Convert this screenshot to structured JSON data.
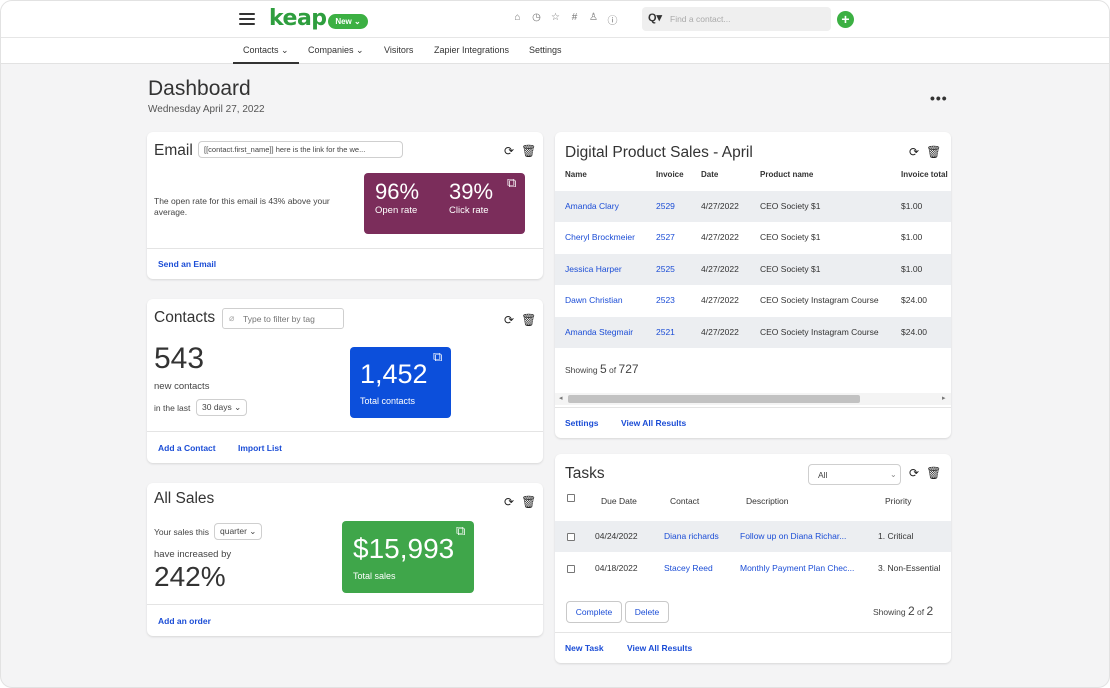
{
  "topbar": {
    "logo": "keap",
    "new_label": "New ⌄",
    "icons": [
      "home-icon",
      "history-icon",
      "star-icon",
      "hash-icon",
      "user-icon",
      "help-icon"
    ],
    "search_icon": "Q▾",
    "search_placeholder": "Find a contact...",
    "add_label": "+"
  },
  "nav": {
    "items": [
      "Contacts ⌄",
      "Companies ⌄",
      "Visitors",
      "Zapier Integrations",
      "Settings"
    ]
  },
  "header": {
    "title": "Dashboard",
    "date": "Wednesday April 27, 2022",
    "more": "•••"
  },
  "email_card": {
    "title": "Email",
    "select_value": "[[contact.first_name]] here is the link for the we...",
    "message": "The open rate for this email is 43% above your average.",
    "open_rate": "96%",
    "open_label": "Open rate",
    "click_rate": "39%",
    "click_label": "Click rate",
    "footer_link": "Send an Email",
    "tile_color": "#7b2d5b"
  },
  "contacts_card": {
    "title": "Contacts",
    "filter_placeholder": "Type to filter by tag",
    "count": "543",
    "count_label": "new contacts",
    "period_prefix": "in the last",
    "period_value": "30 days ⌄",
    "total": "1,452",
    "total_label": "Total contacts",
    "links": [
      "Add a Contact",
      "Import List"
    ],
    "tile_color": "#0c4fdb"
  },
  "sales_card": {
    "title": "All Sales",
    "prefix": "Your sales this",
    "period_value": "quarter ⌄",
    "increase_label": "have increased by",
    "increase": "242%",
    "total": "$15,993",
    "total_label": "Total sales",
    "footer_link": "Add an order",
    "tile_color": "#3fa64a"
  },
  "product_card": {
    "title": "Digital Product Sales - April",
    "columns": [
      "Name",
      "Invoice",
      "Date",
      "Product name",
      "Invoice total"
    ],
    "rows": [
      {
        "name": "Amanda Clary",
        "invoice": "2529",
        "date": "4/27/2022",
        "product": "CEO Society $1",
        "total": "$1.00"
      },
      {
        "name": "Cheryl Brockmeier",
        "invoice": "2527",
        "date": "4/27/2022",
        "product": "CEO Society $1",
        "total": "$1.00"
      },
      {
        "name": "Jessica Harper",
        "invoice": "2525",
        "date": "4/27/2022",
        "product": "CEO Society $1",
        "total": "$1.00"
      },
      {
        "name": "Dawn Christian",
        "invoice": "2523",
        "date": "4/27/2022",
        "product": "CEO Society Instagram Course",
        "total": "$24.00"
      },
      {
        "name": "Amanda Stegmair",
        "invoice": "2521",
        "date": "4/27/2022",
        "product": "CEO Society Instagram Course",
        "total": "$24.00"
      }
    ],
    "showing_prefix": "Showing",
    "showing_count": "5",
    "showing_of": "of",
    "showing_total": "727",
    "links": [
      "Settings",
      "View All Results"
    ]
  },
  "tasks_card": {
    "title": "Tasks",
    "filter_value": "All",
    "columns": [
      "Due Date",
      "Contact",
      "Description",
      "Priority"
    ],
    "rows": [
      {
        "due": "04/24/2022",
        "contact": "Diana richards",
        "description": "Follow up on Diana Richar...",
        "priority": "1. Critical"
      },
      {
        "due": "04/18/2022",
        "contact": "Stacey Reed",
        "description": "Monthly Payment Plan Chec...",
        "priority": "3. Non-Essential"
      }
    ],
    "complete_label": "Complete",
    "delete_label": "Delete",
    "showing_prefix": "Showing",
    "showing_count": "2",
    "showing_of": "of",
    "showing_total": "2",
    "links": [
      "New Task",
      "View All Results"
    ]
  },
  "icons": {
    "refresh": "⟳",
    "trash": "🗑",
    "external": "⧉"
  }
}
